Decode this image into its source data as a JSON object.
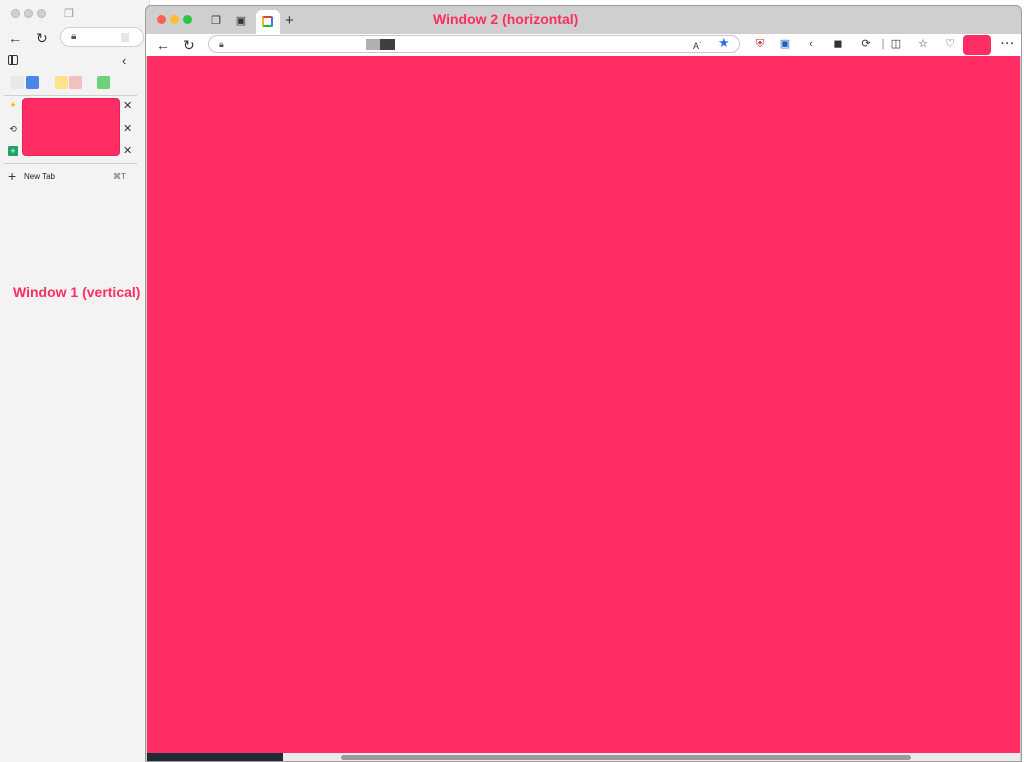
{
  "annotations": {
    "window1_label": "Window 1 (vertical)",
    "window2_label": "Window 2 (horizontal)"
  },
  "window1": {
    "vertical_tabs": {
      "new_tab_label": "New Tab",
      "new_tab_shortcut": "⌘T"
    },
    "pinned_tab_colors": [
      "#e8e8e8",
      "#4a86e8",
      "#ffe38a",
      "#f3c0c0",
      "#6fd07a"
    ],
    "tab_thumbnail_color": "#ff2d63",
    "tab_icons": [
      "sparkle-icon",
      "history-icon",
      "sheets-icon"
    ]
  },
  "window2": {
    "content_color": "#ff2d63",
    "profile_color": "#ff2d63",
    "star_color": "#2d6fe0",
    "extension_icons": [
      "shield-extension-icon",
      "bitwarden-icon",
      "arrow-icon",
      "badge-extension-icon",
      "refresh-extension-icon",
      "split-screen-icon",
      "favorites-icon",
      "heart-pulse-icon"
    ]
  }
}
